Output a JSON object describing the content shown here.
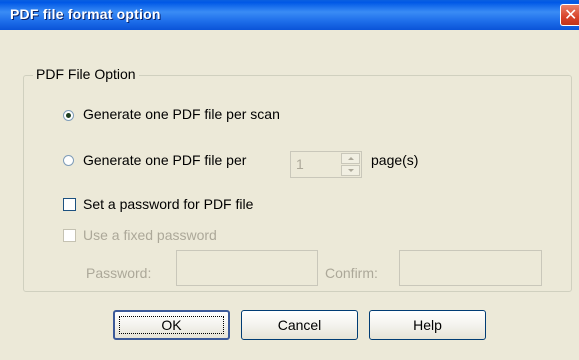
{
  "window": {
    "title": "PDF file format option",
    "close_glyph": "✕"
  },
  "group": {
    "label": "PDF File Option"
  },
  "options": {
    "per_scan_label": "Generate one PDF file per scan",
    "per_scan_selected": true,
    "per_pages_label": "Generate one PDF file per",
    "per_pages_selected": false,
    "pages_value": "1",
    "pages_unit": "page(s)",
    "set_password_label": "Set a password for PDF file",
    "set_password_checked": false,
    "fixed_password_label": "Use a fixed password",
    "fixed_password_checked": false,
    "fixed_password_enabled": false
  },
  "fields": {
    "password_label": "Password:",
    "confirm_label": "Confirm:",
    "password_value": "",
    "confirm_value": ""
  },
  "buttons": {
    "ok": "OK",
    "cancel": "Cancel",
    "help": "Help"
  },
  "icons": {
    "close": "close-icon",
    "spin_up": "arrow-up-icon",
    "spin_down": "arrow-down-icon"
  },
  "colors": {
    "titlebar": "#0058E6",
    "dialog_bg": "#ECE9D8",
    "disabled_text": "#ACA899",
    "close_button": "#D9432A"
  }
}
